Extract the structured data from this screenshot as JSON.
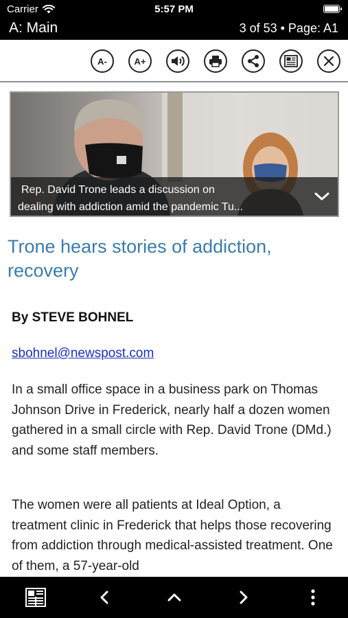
{
  "status": {
    "carrier": "Carrier",
    "time": "5:57 PM",
    "battery_level": 1.0
  },
  "header": {
    "section": "A: Main",
    "page_info": "3 of 53 • Page: A1"
  },
  "toolbar": {
    "font_decrease": "A-",
    "font_increase": "A+",
    "icons": [
      "speaker-icon",
      "print-icon",
      "share-icon",
      "newspaper-icon",
      "close-icon"
    ]
  },
  "photo": {
    "caption_line1": "Rep. David Trone leads a discussion on",
    "caption_line2": "dealing with addiction amid the pandemic Tu..."
  },
  "article": {
    "headline": "Trone hears stories of addiction, recovery",
    "byline": "By STEVE BOHNEL",
    "email": "sbohnel@newspost.com",
    "paragraphs": [
      "In a small office space in a business park on Thomas Johnson Drive in Frederick, nearly half a dozen women gathered in a small circle with Rep. David Trone (DMd.) and some staff members.",
      "The women were all patients at Ideal Option, a treatment clinic in Frederick that helps those recovering from addiction through medical-assisted treatment. One of them, a 57-year-old"
    ]
  },
  "bottom_nav": [
    "pages-icon",
    "chevron-left-icon",
    "chevron-up-icon",
    "chevron-right-icon",
    "more-vertical-icon"
  ],
  "colors": {
    "headline": "#3b7ca9",
    "link": "#1d2fb7",
    "bars": "#000000"
  }
}
